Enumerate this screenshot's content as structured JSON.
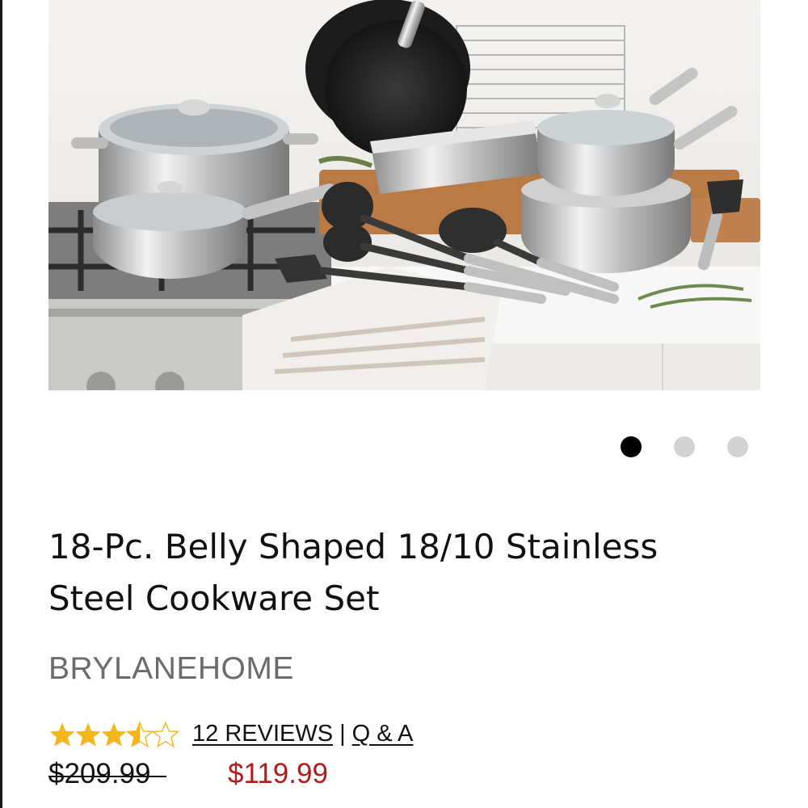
{
  "product": {
    "title": "18-Pc. Belly Shaped 18/10 Stainless Steel Cookware Set",
    "brand": "BRYLANEHOME",
    "rating": 3.5,
    "rating_max": 5,
    "reviews_label": "12 REVIEWS",
    "separator": "|",
    "qa_label": "Q & A",
    "original_price": "$209.99",
    "sale_price": "$119.99"
  },
  "carousel": {
    "total": 3,
    "active_index": 0
  },
  "colors": {
    "star_fill": "#f5b51d",
    "sale_price": "#b31b1b",
    "dot_active": "#000000",
    "dot_inactive": "#d2d2d2"
  }
}
